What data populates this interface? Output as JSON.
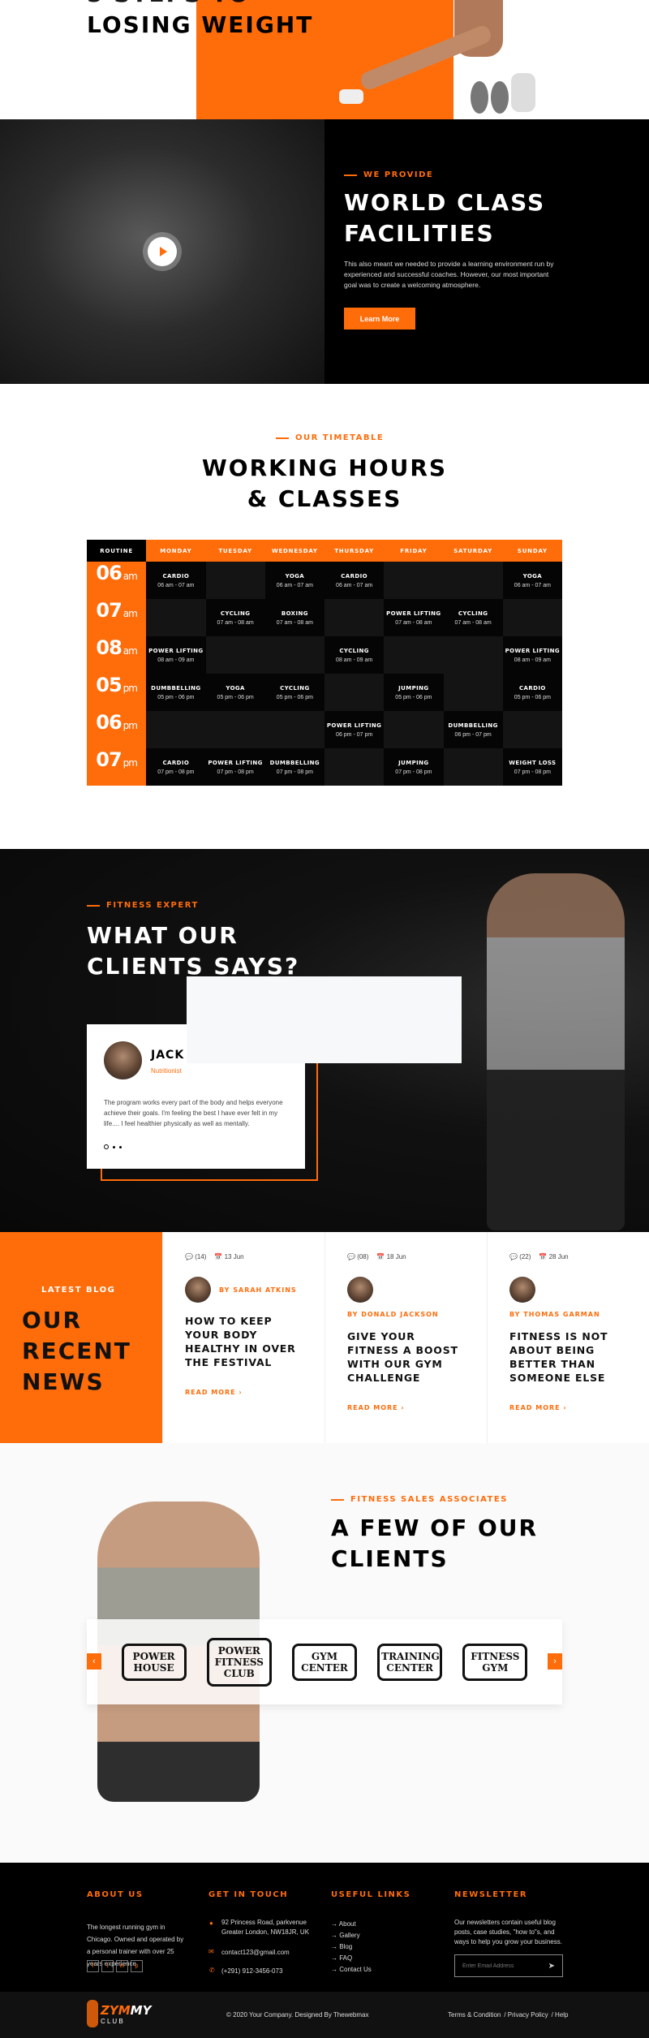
{
  "colors": {
    "accent": "#ff6c0a",
    "dark": "#000000"
  },
  "hero": {
    "title": "LOSING WEIGHT"
  },
  "facilities": {
    "label": "WE PROVIDE",
    "title_lines": [
      "WORLD CLASS",
      "FACILITIES"
    ],
    "body": "This also meant we needed to provide a learning environment run by experienced and successful coaches. However, our most important goal was to create a welcoming atmosphere.",
    "button": "Learn More",
    "play_icon": "play-icon"
  },
  "timetable": {
    "label": "OUR TIMETABLE",
    "title_lines": [
      "WORKING HOURS",
      "& CLASSES"
    ],
    "headers": [
      "ROUTINE",
      "MONDAY",
      "TUESDAY",
      "WEDNESDAY",
      "THURSDAY",
      "FRIDAY",
      "SATURDAY",
      "SUNDAY"
    ],
    "rows": [
      {
        "hour": "06",
        "period": "am",
        "cells": [
          [
            "CARDIO",
            "06 am - 07 am"
          ],
          null,
          [
            "YOGA",
            "06 am - 07 am"
          ],
          [
            "CARDIO",
            "06 am - 07 am"
          ],
          null,
          null,
          [
            "YOGA",
            "06 am - 07 am"
          ]
        ]
      },
      {
        "hour": "07",
        "period": "am",
        "cells": [
          null,
          [
            "CYCLING",
            "07 am - 08 am"
          ],
          [
            "BOXING",
            "07 am - 08 am"
          ],
          null,
          [
            "POWER LIFTING",
            "07 am - 08 am"
          ],
          [
            "CYCLING",
            "07 am - 08 am"
          ],
          null
        ]
      },
      {
        "hour": "08",
        "period": "am",
        "cells": [
          [
            "POWER LIFTING",
            "08 am - 09 am"
          ],
          null,
          null,
          [
            "CYCLING",
            "08 am - 09 am"
          ],
          null,
          null,
          [
            "POWER LIFTING",
            "08 am - 09 am"
          ]
        ]
      },
      {
        "hour": "05",
        "period": "pm",
        "cells": [
          [
            "DUMBBELLING",
            "05 pm - 06 pm"
          ],
          [
            "YOGA",
            "05 pm - 06 pm"
          ],
          [
            "CYCLING",
            "05 pm - 06 pm"
          ],
          null,
          [
            "JUMPING",
            "05 pm - 06 pm"
          ],
          null,
          [
            "CARDIO",
            "05 pm - 06 pm"
          ]
        ]
      },
      {
        "hour": "06",
        "period": "pm",
        "cells": [
          null,
          null,
          null,
          [
            "POWER LIFTING",
            "06 pm - 07 pm"
          ],
          null,
          [
            "DUMBBELLING",
            "06 pm - 07 pm"
          ],
          null
        ]
      },
      {
        "hour": "07",
        "period": "pm",
        "cells": [
          [
            "CARDIO",
            "07 pm - 08 pm"
          ],
          [
            "POWER LIFTING",
            "07 pm - 08 pm"
          ],
          [
            "DUMBBELLING",
            "07 pm - 08 pm"
          ],
          null,
          [
            "JUMPING",
            "07 pm - 08 pm"
          ],
          null,
          [
            "WEIGHT LOSS",
            "07 pm - 08 pm"
          ]
        ]
      }
    ]
  },
  "testimonials": {
    "label": "FITNESS EXPERT",
    "title_lines": [
      "WHAT OUR",
      "CLIENTS SAYS?"
    ],
    "name": "JACK",
    "role": "Nutritionist",
    "quote": "The program works every part of the body and helps everyone achieve their goals. I'm feeling the best I have ever felt in my life.... I feel healthier physically as well as mentally.",
    "quote_mark": "”",
    "active_dot": 0
  },
  "blog": {
    "label": "LATEST BLOG",
    "title_lines": [
      "OUR",
      "RECENT",
      "NEWS"
    ],
    "posts": [
      {
        "comments": "(14)",
        "date": "13 Jun",
        "author": "BY SARAH ATKINS",
        "title": "HOW TO KEEP YOUR BODY HEALTHY IN OVER THE FESTIVAL",
        "read_more": "READ MORE"
      },
      {
        "comments": "(08)",
        "date": "18 Jun",
        "author": "BY DONALD JACKSON",
        "title": "GIVE YOUR FITNESS A BOOST WITH OUR GYM CHALLENGE",
        "read_more": "READ MORE"
      },
      {
        "comments": "(22)",
        "date": "28 Jun",
        "author": "BY THOMAS GARMAN",
        "title": "FITNESS IS NOT ABOUT BEING BETTER THAN SOMEONE ELSE",
        "read_more": "READ MORE"
      }
    ]
  },
  "clients": {
    "label": "FITNESS SALES ASSOCIATES",
    "title_lines": [
      "A FEW OF OUR",
      "CLIENTS"
    ],
    "logos": [
      "POWER HOUSE",
      "POWER FITNESS CLUB",
      "GYM CENTER",
      "TRAINING CENTER",
      "FITNESS GYM"
    ],
    "prev": "‹",
    "next": "›"
  },
  "footer": {
    "about": {
      "heading": "ABOUT US",
      "text": "The longest running gym in Chicago. Owned and operated by a personal trainer with over 25 years experience",
      "social": [
        "f",
        "t",
        "in",
        "p"
      ]
    },
    "contact": {
      "heading": "GET IN TOUCH",
      "address": "92 Princess Road, parkvenue Greater London, NW18JR, UK",
      "email": "contact123@gmail.com",
      "phone": "(+291) 912-3456-073"
    },
    "links": {
      "heading": "USEFUL LINKS",
      "items": [
        "About",
        "Gallery",
        "Blog",
        "FAQ",
        "Contact Us"
      ]
    },
    "newsletter": {
      "heading": "NEWSLETTER",
      "text": "Our newsletters contain useful blog posts, case studies, \"how to\"s, and ways to help you grow your business.",
      "placeholder": "Enter Email Address"
    },
    "brand": {
      "name_a": "ZYM",
      "name_b": "MY",
      "sub": "C L U B"
    },
    "copyright": "© 2020 Your Company. Designed By Thewebmax",
    "legal": [
      "Terms & Condition",
      "/ Privacy Policy",
      "/ Help"
    ]
  }
}
